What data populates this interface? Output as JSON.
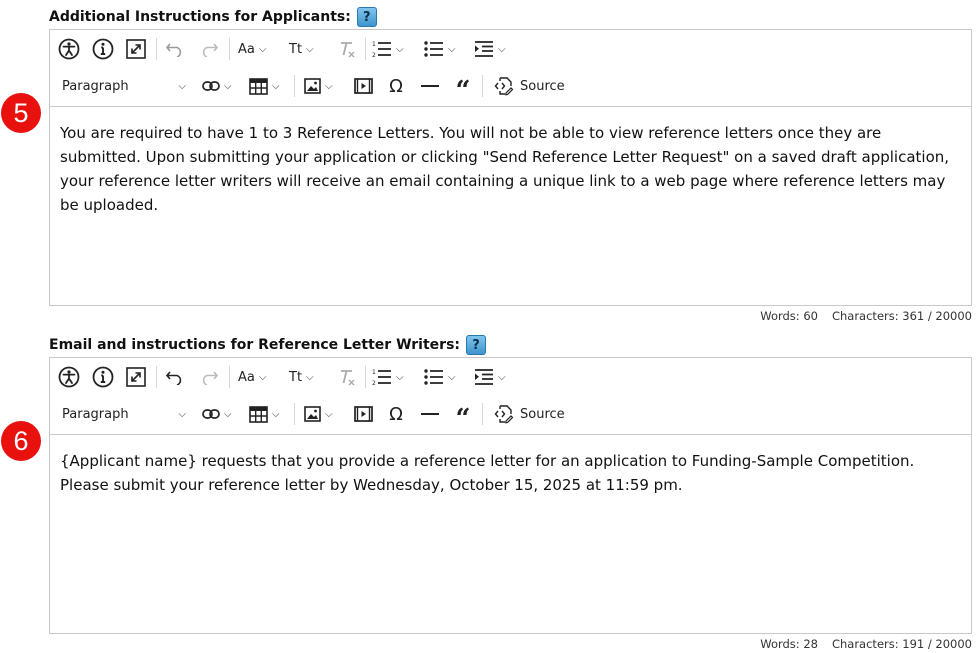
{
  "sections": [
    {
      "label": "Additional Instructions for Applicants:",
      "marker": "5",
      "help": "?",
      "block_format": "Paragraph",
      "source_label": "Source",
      "content": "You are required to have 1 to 3 Reference Letters. You will not be able to view reference letters once they are submitted. Upon submitting your application or clicking \"Send Reference Letter Request\" on a saved draft application, your reference letter writers will receive an email containing a unique link to a web page where reference letters may be uploaded.",
      "words": "Words: 60",
      "characters": "Characters: 361 / 20000"
    },
    {
      "label": "Email and instructions for Reference Letter Writers:",
      "marker": "6",
      "help": "?",
      "block_format": "Paragraph",
      "source_label": "Source",
      "content": "{Applicant name} requests that you provide a reference letter for an application to Funding-Sample Competition. Please submit your reference letter by Wednesday, October 15, 2025 at 11:59 pm.",
      "words": "Words: 28",
      "characters": "Characters: 191 / 20000"
    }
  ],
  "toolbar": {
    "font_family_label": "Aa",
    "font_size_label": "Tt",
    "icons": [
      "accessibility-icon",
      "info-icon",
      "fullscreen-icon",
      "undo-icon",
      "redo-icon",
      "font-family-icon",
      "font-size-icon",
      "remove-format-icon",
      "numbered-list-icon",
      "bulleted-list-icon",
      "indent-icon",
      "link-icon",
      "table-icon",
      "image-icon",
      "media-icon",
      "special-characters-icon",
      "horizontal-line-icon",
      "blockquote-icon",
      "source-icon"
    ]
  },
  "colors": {
    "marker": "#e8110d",
    "help": "#3f94cc",
    "border": "#c8c8c8"
  }
}
